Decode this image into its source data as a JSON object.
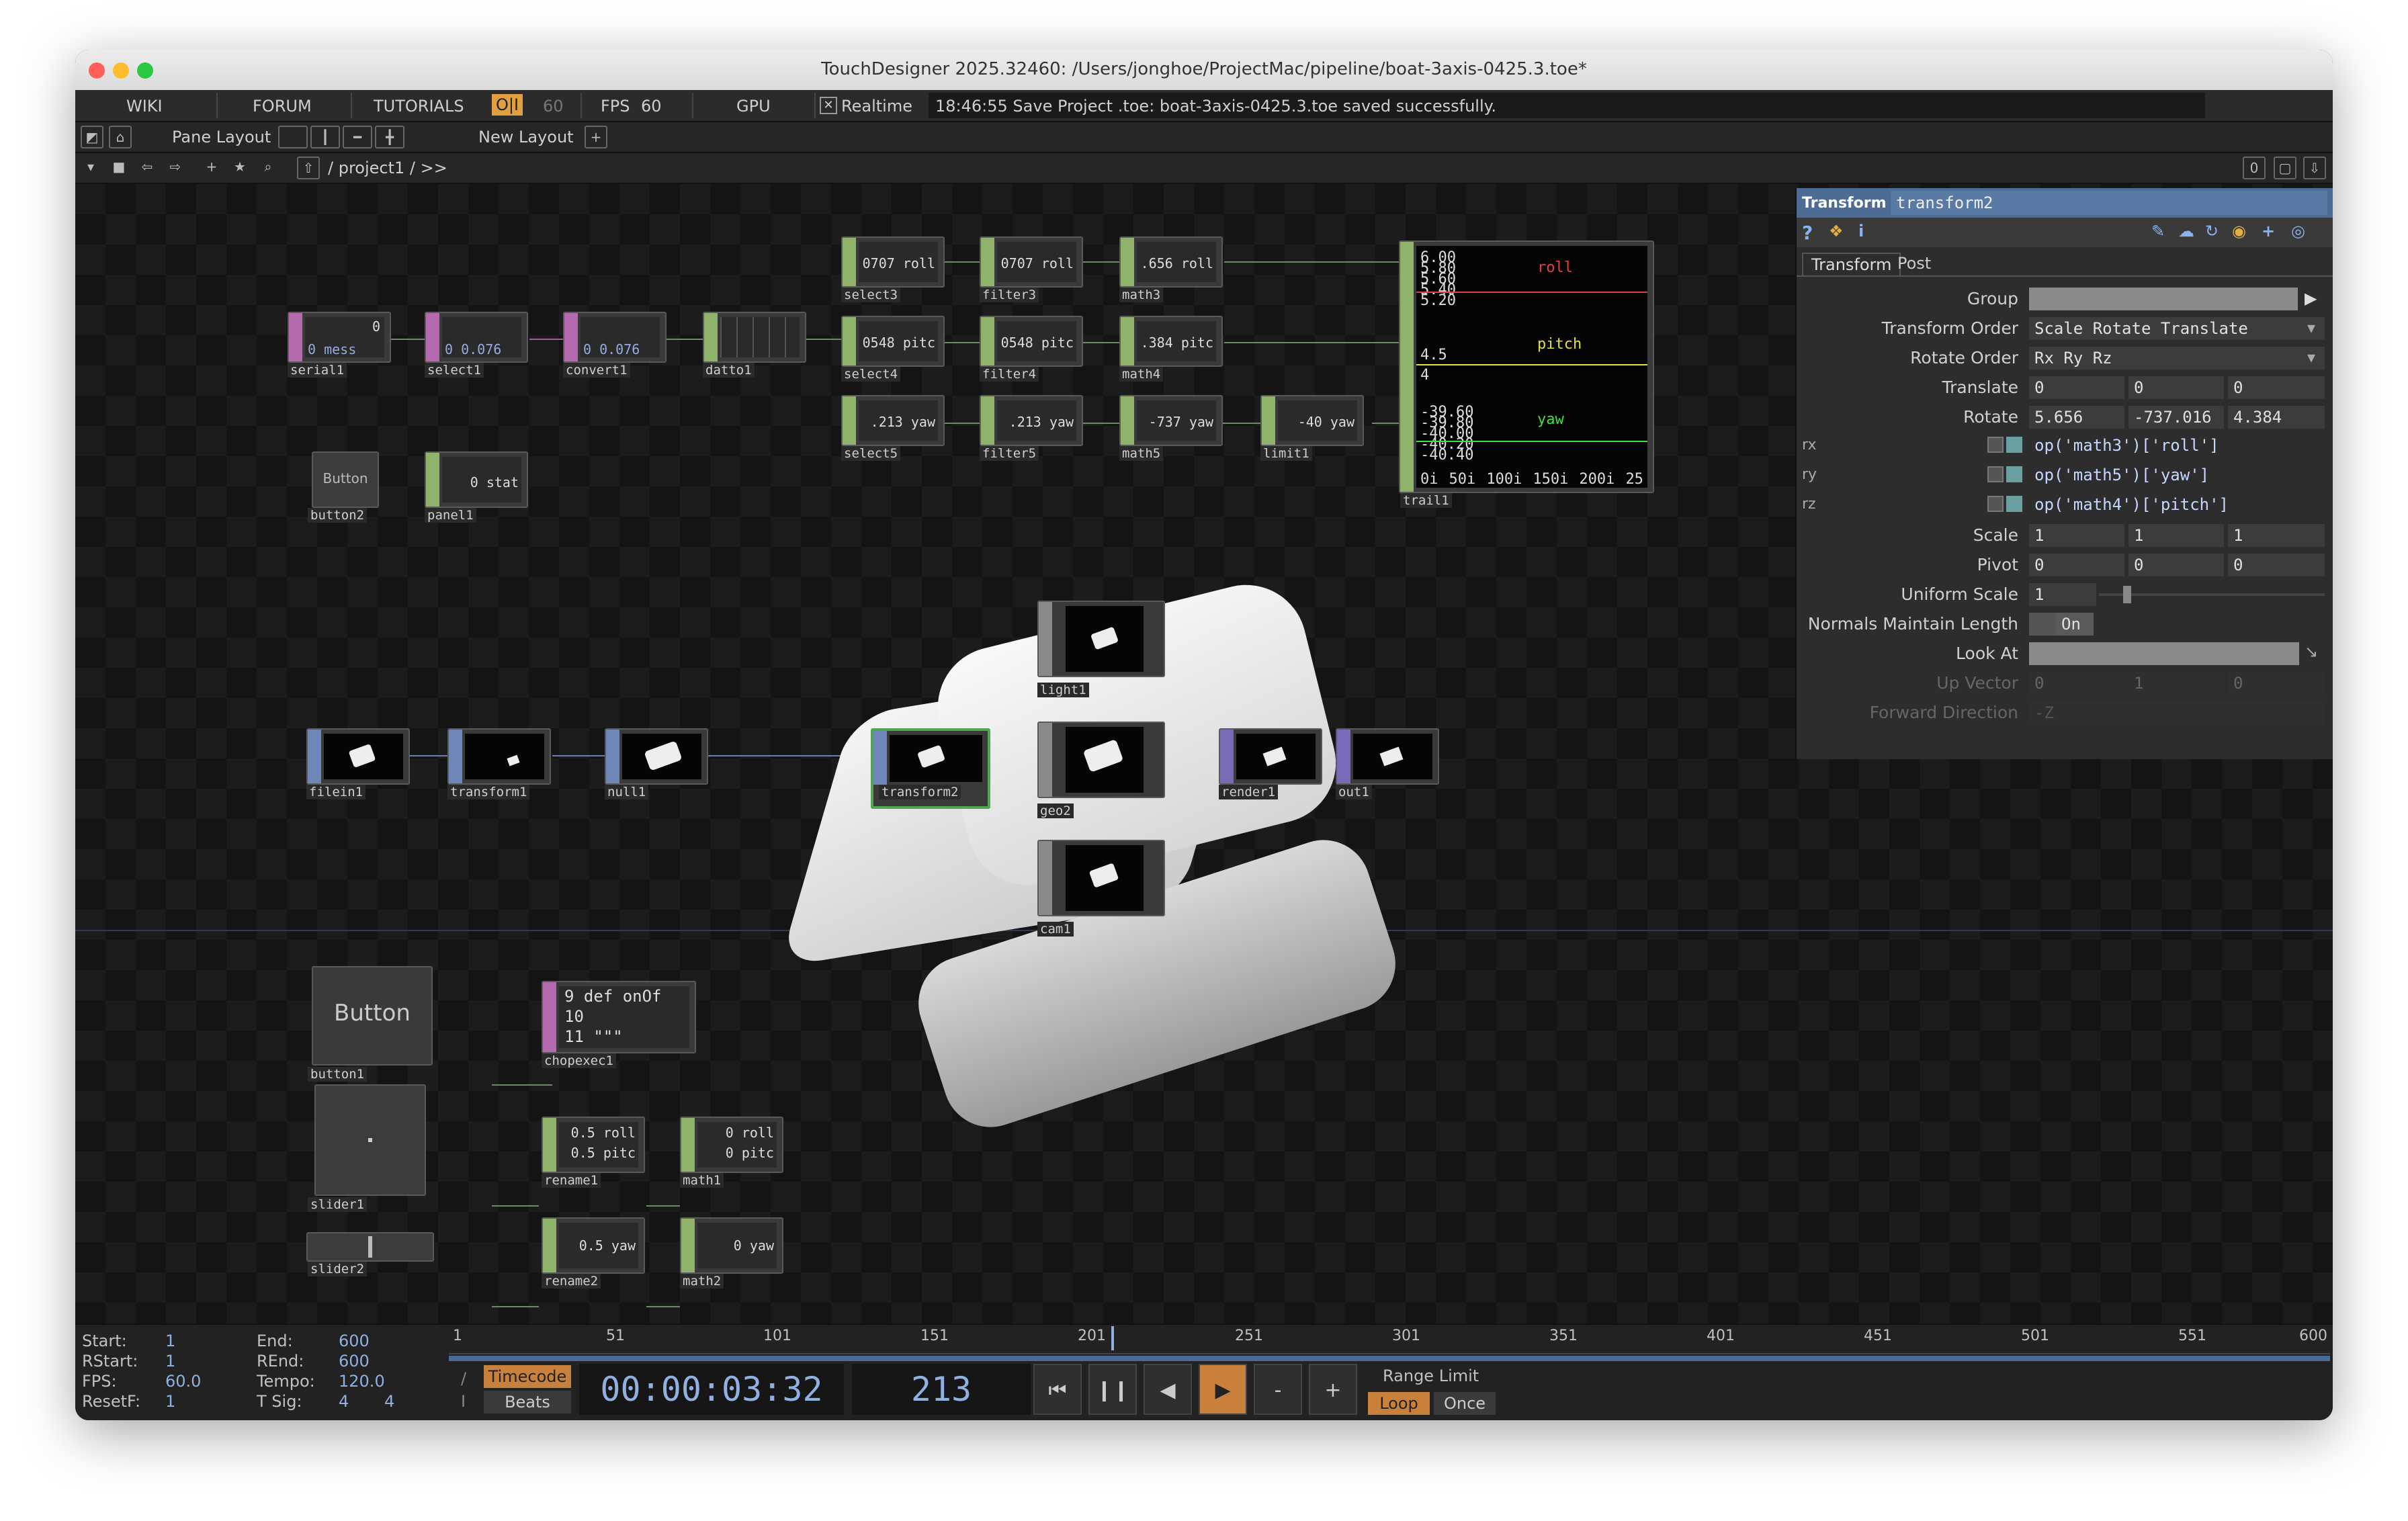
{
  "window": {
    "title": "TouchDesigner 2025.32460: /Users/jonghoe/ProjectMac/pipeline/boat-3axis-0425.3.toe*"
  },
  "menu": {
    "wiki": "WIKI",
    "forum": "FORUM",
    "tutorials": "TUTORIALS",
    "oi": "O|I",
    "oi_value": "60",
    "fps_label": "FPS",
    "fps_value": "60",
    "gpu": "GPU",
    "realtime": "Realtime",
    "status": "18:46:55 Save Project .toe: boat-3axis-0425.3.toe saved successfully."
  },
  "toolbar": {
    "pane_layout": "Pane Layout",
    "new_layout": "New Layout",
    "path": "/ project1 / >>",
    "counter": "0"
  },
  "nodes": {
    "serial1": {
      "label": "serial1",
      "text1": "0",
      "text2": "0 mess"
    },
    "select1": {
      "label": "select1",
      "text": "0 0.076"
    },
    "convert1": {
      "label": "convert1",
      "text": "0 0.076"
    },
    "datto1": {
      "label": "datto1"
    },
    "button2": {
      "label": "button2",
      "text": "Button"
    },
    "panel1": {
      "label": "panel1",
      "text": "0 stat"
    },
    "select3": {
      "label": "select3",
      "text": "0707 roll"
    },
    "filter3": {
      "label": "filter3",
      "text": "0707 roll"
    },
    "math3": {
      "label": "math3",
      "text": ".656 roll"
    },
    "select4": {
      "label": "select4",
      "text": "0548 pitc"
    },
    "filter4": {
      "label": "filter4",
      "text": "0548 pitc"
    },
    "math4": {
      "label": "math4",
      "text": ".384 pitc"
    },
    "select5": {
      "label": "select5",
      "text": ".213 yaw"
    },
    "filter5": {
      "label": "filter5",
      "text": ".213 yaw"
    },
    "math5": {
      "label": "math5",
      "text": "-737 yaw"
    },
    "limit1": {
      "label": "limit1",
      "text": "-40 yaw"
    },
    "trail1": {
      "label": "trail1"
    },
    "filein1": {
      "label": "filein1"
    },
    "transform1": {
      "label": "transform1"
    },
    "null1": {
      "label": "null1"
    },
    "transform2": {
      "label": "transform2"
    },
    "light1": {
      "label": "light1"
    },
    "geo2": {
      "label": "geo2"
    },
    "cam1": {
      "label": "cam1"
    },
    "render1": {
      "label": "render1"
    },
    "out1": {
      "label": "out1"
    },
    "button1": {
      "label": "button1",
      "text": "Button"
    },
    "chopexec1": {
      "label": "chopexec1",
      "line1": "9  def onOf",
      "line2": "10",
      "line3": "11     \"\"\""
    },
    "slider1": {
      "label": "slider1"
    },
    "rename1": {
      "label": "rename1",
      "line1": "0.5 roll",
      "line2": "0.5 pitc"
    },
    "math1": {
      "label": "math1",
      "line1": "0 roll",
      "line2": "0 pitc"
    },
    "slider2": {
      "label": "slider2"
    },
    "rename2": {
      "label": "rename2",
      "text": "0.5 yaw"
    },
    "math2": {
      "label": "math2",
      "text": "0 yaw"
    }
  },
  "trail": {
    "roll_ticks": [
      "6.00",
      "5.80",
      "5.60",
      "5.40",
      "5.20"
    ],
    "pitch_ticks": [
      "4.5",
      "4"
    ],
    "yaw_ticks": [
      "-39.60",
      "-39.80",
      "-40.00",
      "-40.20",
      "-40.40"
    ],
    "x_ticks": [
      "0i",
      "50i",
      "100i",
      "150i",
      "200i",
      "25"
    ],
    "roll": "roll",
    "pitch": "pitch",
    "yaw": "yaw",
    "colors": {
      "roll": "#e04040",
      "pitch": "#e0e040",
      "yaw": "#40e040"
    }
  },
  "params": {
    "op_type": "Transform",
    "op_name": "transform2",
    "tab_transform": "Transform",
    "tab_post": "Post",
    "rows": {
      "group": "Group",
      "transform_order": "Transform Order",
      "transform_order_value": "Scale Rotate Translate",
      "rotate_order": "Rotate Order",
      "rotate_order_value": "Rx Ry Rz",
      "translate": "Translate",
      "translate_x": "0",
      "translate_y": "0",
      "translate_z": "0",
      "rotate": "Rotate",
      "rotate_x": "5.656",
      "rotate_y": "-737.016",
      "rotate_z": "4.384",
      "rx": "rx",
      "rx_expr": "op('math3')['roll']",
      "ry": "ry",
      "ry_expr": "op('math5')['yaw']",
      "rz": "rz",
      "rz_expr": "op('math4')['pitch']",
      "scale": "Scale",
      "scale_x": "1",
      "scale_y": "1",
      "scale_z": "1",
      "pivot": "Pivot",
      "pivot_x": "0",
      "pivot_y": "0",
      "pivot_z": "0",
      "uniform_scale": "Uniform Scale",
      "uniform_scale_value": "1",
      "normals": "Normals Maintain Length",
      "normals_value": "On",
      "look_at": "Look At",
      "up_vector": "Up Vector",
      "up_x": "0",
      "up_y": "1",
      "up_z": "0",
      "forward": "Forward Direction",
      "forward_value": "-Z"
    }
  },
  "timeline": {
    "start_label": "Start:",
    "start": "1",
    "end_label": "End:",
    "end": "600",
    "rstart_label": "RStart:",
    "rstart": "1",
    "rend_label": "REnd:",
    "rend": "600",
    "fps_label": "FPS:",
    "fps": "60.0",
    "tempo_label": "Tempo:",
    "tempo": "120.0",
    "resetf_label": "ResetF:",
    "resetf": "1",
    "tsig_label": "T Sig:",
    "tsig1": "4",
    "tsig2": "4",
    "ruler": [
      "1",
      "51",
      "101",
      "151",
      "201",
      "251",
      "301",
      "351",
      "401",
      "451",
      "501",
      "551",
      "600"
    ],
    "timecode_btn": "Timecode",
    "beats_btn": "Beats",
    "timecode": "00:00:03:32",
    "frame": "213",
    "range_limit": "Range Limit",
    "loop": "Loop",
    "once": "Once",
    "minus": "-",
    "plus": "+"
  }
}
